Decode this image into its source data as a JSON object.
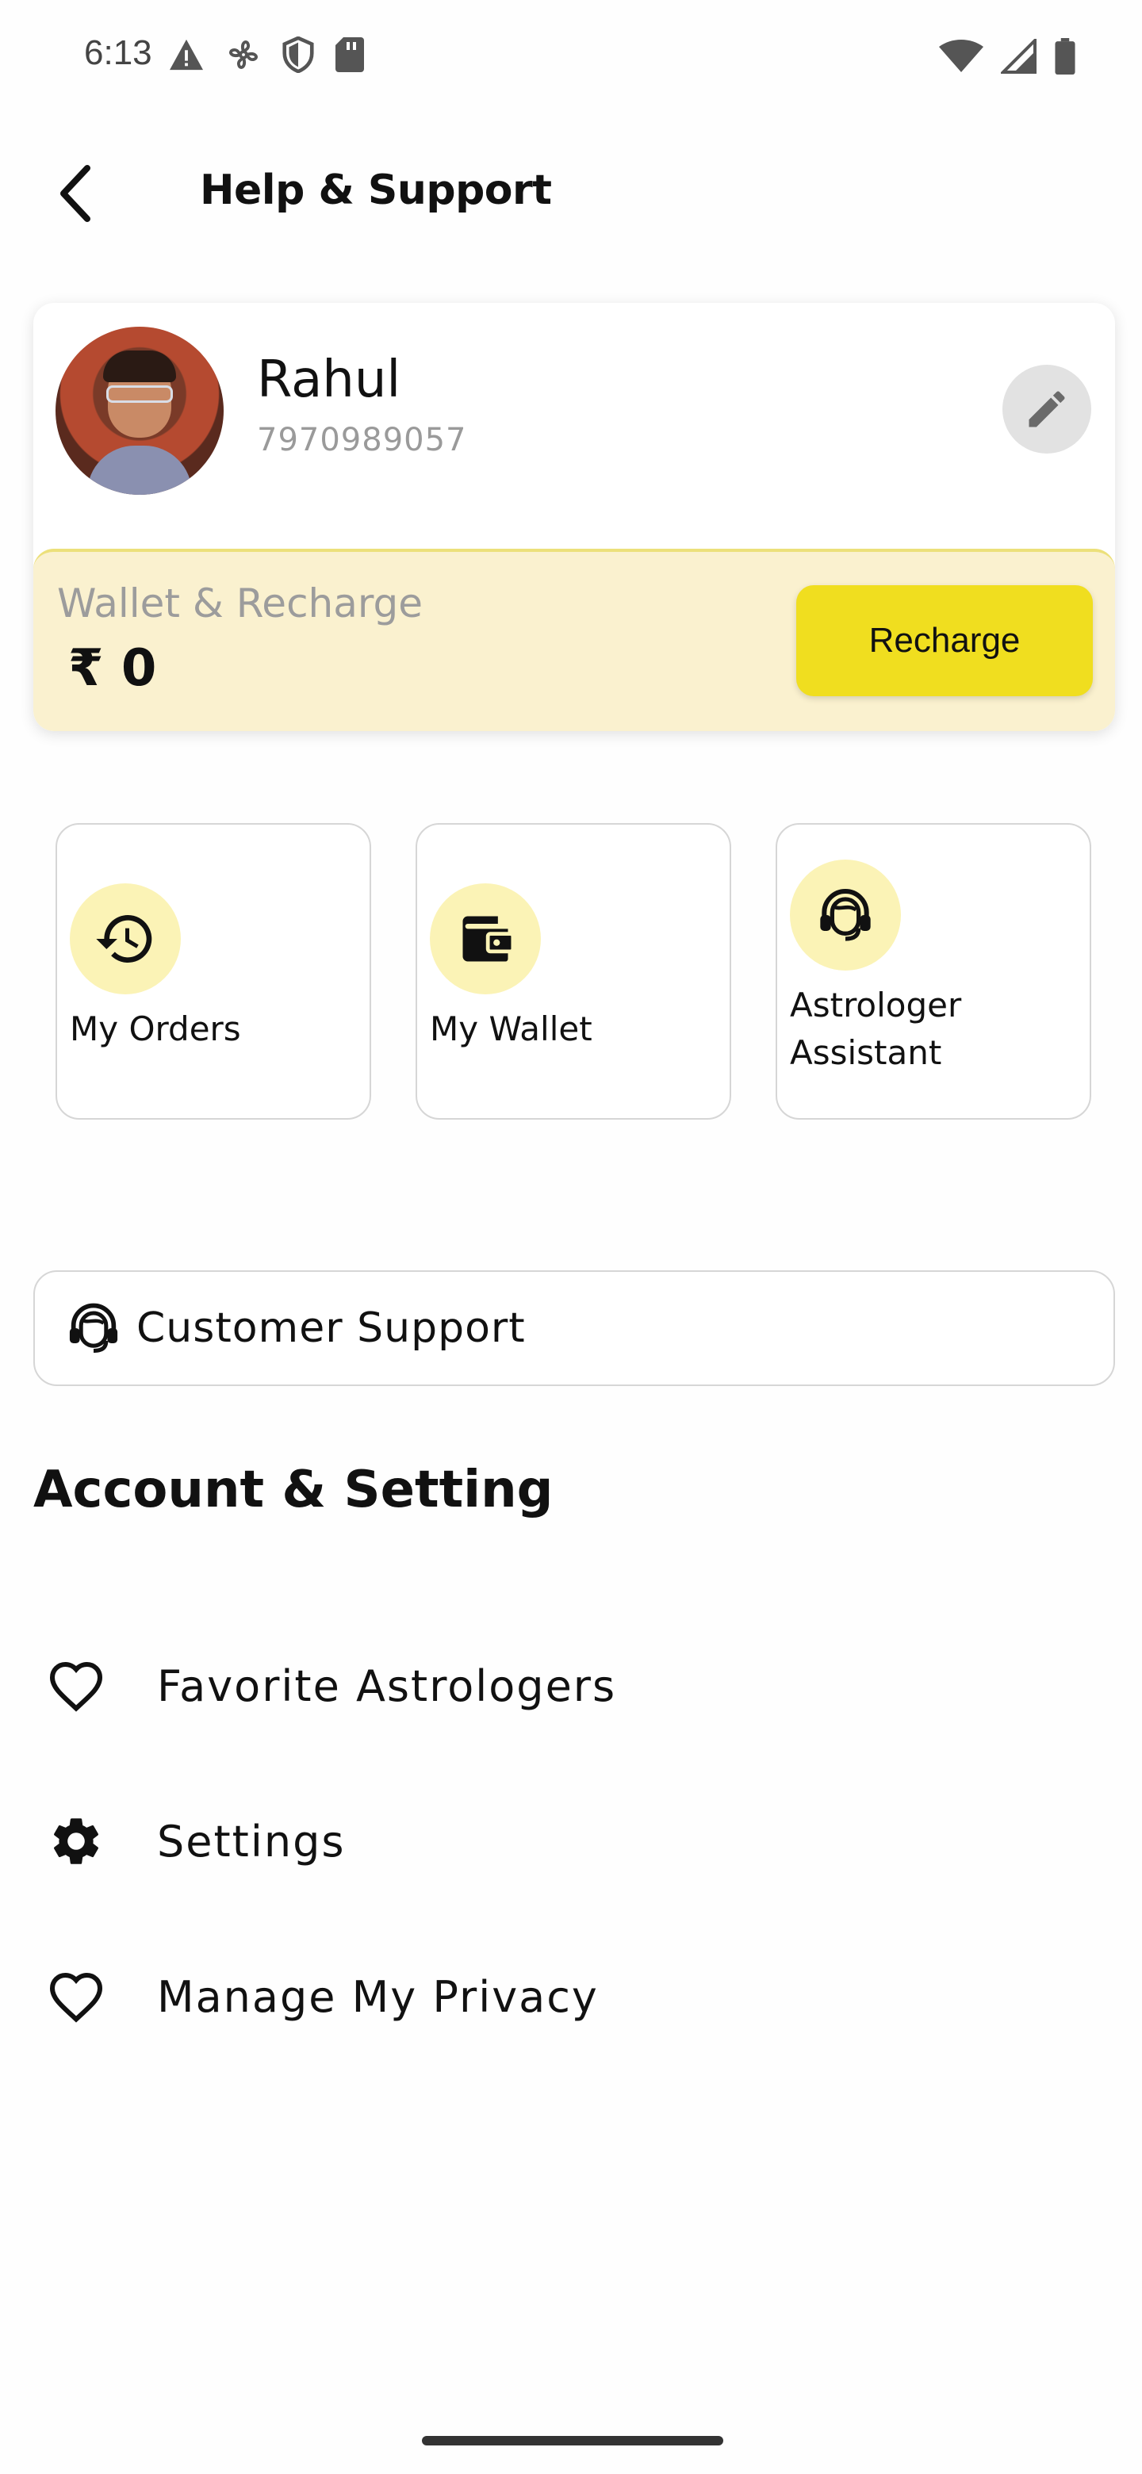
{
  "status_bar": {
    "time": "6:13"
  },
  "header": {
    "title": "Help & Support"
  },
  "profile": {
    "name": "Rahul",
    "phone": "7970989057"
  },
  "wallet": {
    "label": "Wallet & Recharge",
    "amount": "₹ 0",
    "recharge_label": "Recharge"
  },
  "tiles": [
    {
      "label": "My Orders",
      "icon": "history-icon"
    },
    {
      "label": "My Wallet",
      "icon": "wallet-icon"
    },
    {
      "label": "Astrologer Assistant",
      "icon": "headset-icon"
    }
  ],
  "support": {
    "label": "Customer Support",
    "icon": "headset-icon"
  },
  "account": {
    "title": "Account & Setting",
    "items": [
      {
        "label": "Favorite Astrologers",
        "icon": "heart-icon"
      },
      {
        "label": "Settings",
        "icon": "gear-icon"
      },
      {
        "label": "Manage My Privacy",
        "icon": "heart-icon"
      }
    ]
  },
  "colors": {
    "accent_yellow": "#f0de1f",
    "wallet_bg": "#faf1cf",
    "icon_circle": "#fbf3b6"
  }
}
